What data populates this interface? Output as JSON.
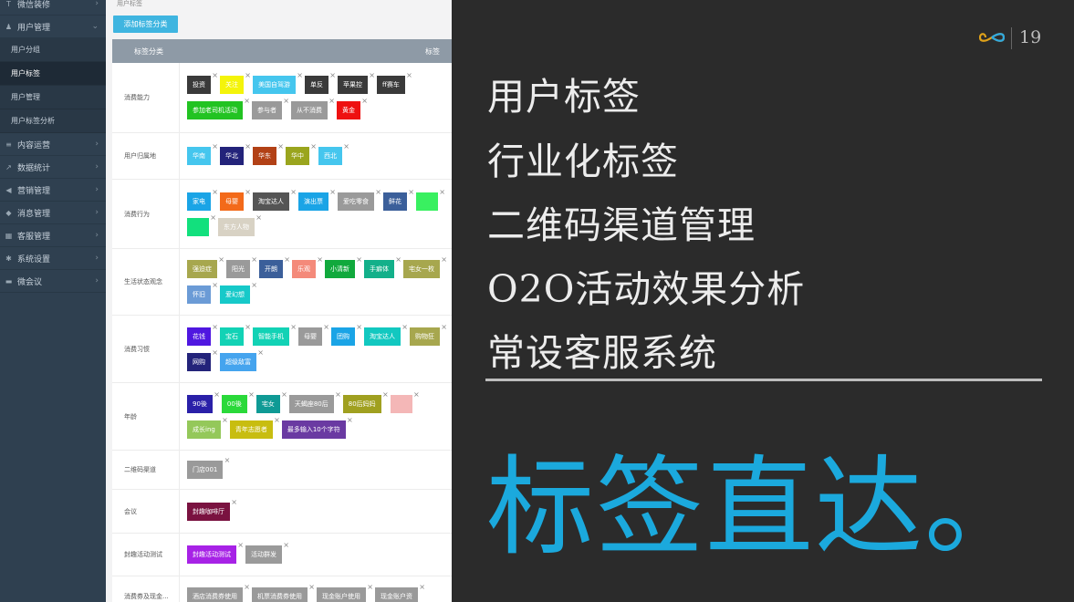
{
  "sidebar": {
    "items": [
      {
        "label": "微信装修",
        "icon": "hammer-icon"
      },
      {
        "label": "用户管理",
        "icon": "user-icon",
        "expanded": true,
        "children": [
          "用户分组",
          "用户标签",
          "用户管理",
          "用户标签分析"
        ],
        "active_child": "用户标签"
      },
      {
        "label": "内容运营",
        "icon": "list-icon"
      },
      {
        "label": "数据统计",
        "icon": "chart-icon"
      },
      {
        "label": "营销管理",
        "icon": "megaphone-icon"
      },
      {
        "label": "消息管理",
        "icon": "tag-icon"
      },
      {
        "label": "客服管理",
        "icon": "grid-icon"
      },
      {
        "label": "系统设置",
        "icon": "gear-icon"
      },
      {
        "label": "微会议",
        "icon": "card-icon"
      }
    ]
  },
  "main": {
    "breadcrumb": "用户标签",
    "add_button": "添加标签分类",
    "headers": [
      "标签分类",
      "标签"
    ],
    "rows": [
      {
        "label": "消费能力",
        "tags": [
          {
            "t": "投资",
            "c": "#3a3a3a"
          },
          {
            "t": "关注",
            "c": "#f4f40a"
          },
          {
            "t": "美国自驾游",
            "c": "#45c6ee"
          },
          {
            "t": "单反",
            "c": "#3a3a3a"
          },
          {
            "t": "苹果控",
            "c": "#3a3a3a"
          },
          {
            "t": "ff赛车",
            "c": "#3a3a3a"
          },
          {
            "t": "参加老司机活动",
            "c": "#22c322"
          },
          {
            "t": "参与者",
            "c": "#9a9a9a"
          },
          {
            "t": "从不消费",
            "c": "#9a9a9a"
          },
          {
            "t": "黄金",
            "c": "#ee1111"
          }
        ]
      },
      {
        "label": "用户归属地",
        "tags": [
          {
            "t": "华南",
            "c": "#45c6ee"
          },
          {
            "t": "华北",
            "c": "#23237a"
          },
          {
            "t": "华东",
            "c": "#b24116"
          },
          {
            "t": "华中",
            "c": "#9aa51e"
          },
          {
            "t": "西北",
            "c": "#45c6ee"
          }
        ]
      },
      {
        "label": "消费行为",
        "tags": [
          {
            "t": "家电",
            "c": "#1aa4e6"
          },
          {
            "t": "母婴",
            "c": "#f36a1a"
          },
          {
            "t": "淘宝达人",
            "c": "#555555"
          },
          {
            "t": "演出票",
            "c": "#1aa4e6"
          },
          {
            "t": "爱吃零食",
            "c": "#9a9a9a"
          },
          {
            "t": "鲜花",
            "c": "#3b5f9a"
          },
          {
            "t": "",
            "c": "#39f060"
          },
          {
            "t": "",
            "c": "#12e07d"
          },
          {
            "t": "东方人物",
            "c": "#d8d2c4"
          }
        ]
      },
      {
        "label": "生活状态观念",
        "tags": [
          {
            "t": "强迫症",
            "c": "#a7a74e"
          },
          {
            "t": "阳光",
            "c": "#9a9a9a"
          },
          {
            "t": "开朗",
            "c": "#3b5f9a"
          },
          {
            "t": "乐观",
            "c": "#f48a7a"
          },
          {
            "t": "小清新",
            "c": "#11a93d"
          },
          {
            "t": "手癖体",
            "c": "#13b08a"
          },
          {
            "t": "宅女一枚",
            "c": "#a7a74e"
          },
          {
            "t": "怀旧",
            "c": "#6b9bd6"
          },
          {
            "t": "爱幻想",
            "c": "#16c9c9"
          }
        ]
      },
      {
        "label": "消费习惯",
        "tags": [
          {
            "t": "花钱",
            "c": "#4f17e0"
          },
          {
            "t": "宝石",
            "c": "#12d2b5"
          },
          {
            "t": "智能手机",
            "c": "#12d2b5"
          },
          {
            "t": "母婴",
            "c": "#9a9a9a"
          },
          {
            "t": "团购",
            "c": "#1aa4e6"
          },
          {
            "t": "淘宝达人",
            "c": "#12c8c0"
          },
          {
            "t": "购物狂",
            "c": "#a7a74e"
          },
          {
            "t": "网购",
            "c": "#23237a"
          },
          {
            "t": "超级敌富",
            "c": "#45a4ee"
          }
        ]
      },
      {
        "label": "年龄",
        "tags": [
          {
            "t": "90後",
            "c": "#2a20a8"
          },
          {
            "t": "00後",
            "c": "#2ad93a"
          },
          {
            "t": "宅女",
            "c": "#0f9a95"
          },
          {
            "t": "天蝎座80后",
            "c": "#9a9a9a"
          },
          {
            "t": "80后妈妈",
            "c": "#a0a020"
          },
          {
            "t": "",
            "c": "#f4b7b7"
          },
          {
            "t": "成长ing",
            "c": "#94c85a"
          },
          {
            "t": "青年志愿者",
            "c": "#c8bd10"
          },
          {
            "t": "最多输入10个字符",
            "c": "#6a3aa2"
          }
        ]
      },
      {
        "label": "二维码渠道",
        "tags": [
          {
            "t": "门店001",
            "c": "#9a9a9a"
          }
        ]
      },
      {
        "label": "会议",
        "tags": [
          {
            "t": "封趣咖啡厅",
            "c": "#7a1240"
          }
        ]
      },
      {
        "label": "封趣活动测试",
        "tags": [
          {
            "t": "封趣活动测试",
            "c": "#a722e6"
          },
          {
            "t": "活动群发",
            "c": "#9a9a9a"
          }
        ]
      },
      {
        "label": "消费券及现金...",
        "tags": [
          {
            "t": "酒店消费券使用",
            "c": "#9a9a9a"
          },
          {
            "t": "机票消费券使用",
            "c": "#9a9a9a"
          },
          {
            "t": "现金账户使用",
            "c": "#9a9a9a"
          },
          {
            "t": "现金账户资",
            "c": "#9a9a9a"
          }
        ]
      }
    ]
  },
  "slide": {
    "page_number": "19",
    "features": [
      "用户标签",
      "行业化标签",
      "二维码渠道管理",
      "O2O活动效果分析",
      "常设客服系统"
    ],
    "slogan": "标签直达。",
    "accent_color": "#1ba9dd",
    "logo_icon": "infinity-logo-icon"
  }
}
